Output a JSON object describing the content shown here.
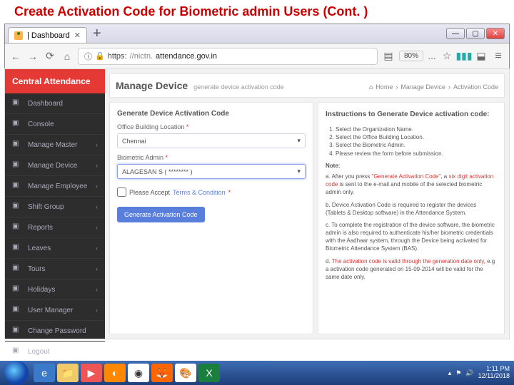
{
  "slide": {
    "title": "Create Activation Code for Biometric admin Users (Cont. )"
  },
  "browser": {
    "tab_title": "| Dashboard",
    "tab_plus": "+",
    "url_protocol": "https:",
    "url_host": "//nictn.",
    "url_rest": "attendance.gov.in",
    "zoom": "80%",
    "win": {
      "min": "—",
      "max": "▢",
      "close": "✕"
    }
  },
  "sidebar": {
    "brand": "Central Attendance",
    "items": [
      {
        "label": "Dashboard",
        "expand": false
      },
      {
        "label": "Console",
        "expand": false
      },
      {
        "label": "Manage Master",
        "expand": true
      },
      {
        "label": "Manage Device",
        "expand": true
      },
      {
        "label": "Manage Employee",
        "expand": true
      },
      {
        "label": "Shift Group",
        "expand": true
      },
      {
        "label": "Reports",
        "expand": true
      },
      {
        "label": "Leaves",
        "expand": true
      },
      {
        "label": "Tours",
        "expand": true
      },
      {
        "label": "Holidays",
        "expand": true
      },
      {
        "label": "User Manager",
        "expand": true
      },
      {
        "label": "Change Password",
        "expand": false
      },
      {
        "label": "Logout",
        "expand": false
      }
    ]
  },
  "page": {
    "title": "Manage Device",
    "subtitle": "generate device activation code",
    "crumb_home": "Home",
    "crumb_1": "Manage Device",
    "crumb_2": "Activation Code"
  },
  "form": {
    "card_title": "Generate Device Activation Code",
    "loc_label": "Office Building Location",
    "loc_value": "Chennai",
    "admin_label": "Biometric Admin",
    "admin_value": "ALAGESAN S ( ******** )",
    "accept_label": "Please Accept",
    "terms_label": "Terms & Condition",
    "button": "Generate Activation Code"
  },
  "instructions": {
    "title": "Instructions to Generate Device activation code:",
    "steps": [
      "Select the Organization Name.",
      "Select the Office Building Location.",
      "Select the Biometric Admin.",
      "Please review the form before submission."
    ],
    "note_label": "Note:",
    "a_pre": "a. After you press ",
    "a_hl": "\"Generate Activation Code\"",
    "a_mid": ", a ",
    "a_hl2": "six digit activation code",
    "a_post": " is sent to the e-mail and mobile of the selected biometric admin only.",
    "b": "b. Device Activation Code is required to register the devices (Tablets & Desktop software) in the Attendance System.",
    "c": "c. To complete the registration of the device software, the biometric admin is also required to authenticate his/her biometric credentials with the Aadhaar system, through the Device being activated for Biometric Attendance System (BAS).",
    "d_pre": "d. ",
    "d_hl": "The activation code is valid through the generation date only,",
    "d_post": " e.g a activation code generated on 15-09-2014 will be valid for the same date only."
  },
  "taskbar": {
    "time": "1:11 PM",
    "date": "12/11/2018"
  }
}
